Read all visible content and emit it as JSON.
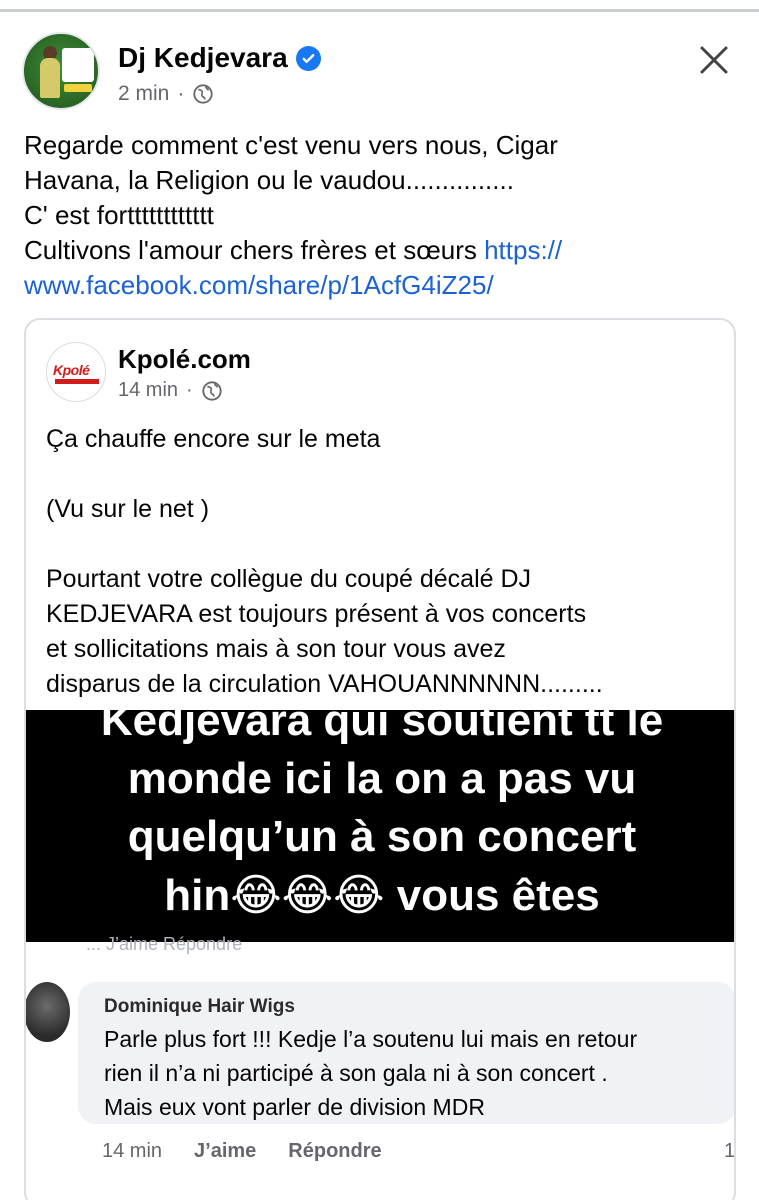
{
  "post": {
    "author": "Dj Kedjevara",
    "time": "2 min",
    "separator": "·",
    "text_lines": [
      "Regarde comment c'est venu vers nous, Cigar",
      "Havana, la Religion ou le vaudou...............",
      "C' est fortttttttttttt",
      "Cultivons l'amour chers frères et sœurs "
    ],
    "link_part1": "https://",
    "link_part2": "www.facebook.com/share/p/1AcfG4iZ25/"
  },
  "shared": {
    "source_name": "Kpolé.com",
    "logo_text": "Kpolé",
    "time": "14 min",
    "separator": "·",
    "text_lines": [
      "Ça chauffe encore sur le meta",
      "",
      "(Vu sur le net )",
      "",
      "Pourtant votre collègue du coupé décalé DJ",
      "KEDJEVARA est toujours présent à vos concerts",
      "et sollicitations mais à son tour vous avez",
      "disparus de la circulation VAHOUANNNNNN........."
    ],
    "image_lines": [
      "Kedjevara qui soutient tt le",
      "monde ici la on a pas vu",
      "quelqu’un à son concert",
      "hin😂😂😂 vous êtes"
    ]
  },
  "comment": {
    "author": "Dominique Hair Wigs",
    "text_lines": [
      "Parle plus fort !!! Kedje l’a soutenu lui mais en retour",
      "rien il n’a ni participé à son gala ni à son concert .",
      "Mais eux vont parler de division MDR"
    ],
    "time": "14 min",
    "like_label": "J’aime",
    "reply_label": "Répondre",
    "edge_mark": "1",
    "ghost_row": "... J’aime  Répondre"
  },
  "colors": {
    "link": "#1a62d6",
    "verified": "#1877f2",
    "meta": "#65676b",
    "bubble": "#f0f2f5"
  }
}
